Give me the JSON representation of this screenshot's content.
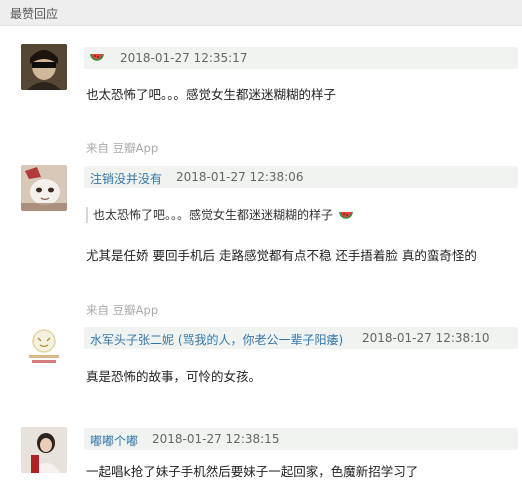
{
  "section": {
    "title": "最赞回应"
  },
  "comments": [
    {
      "author": "",
      "time": "2018-01-27 12:35:17",
      "text": "也太恐怖了吧。。。感觉女生都迷迷糊糊的样子",
      "source": "来自 豆瓣App"
    },
    {
      "author": "注销没并没有",
      "time": "2018-01-27 12:38:06",
      "quote": "也太恐怖了吧。。。感觉女生都迷迷糊糊的样子",
      "text": "尤其是任娇 要回手机后 走路感觉都有点不稳 还手捂着脸 真的蛮奇怪的",
      "source": "来自 豆瓣App"
    },
    {
      "author": "水军头子张二妮 (骂我的人，你老公一辈子阳痿)",
      "time": "2018-01-27 12:38:10",
      "text": "真是恐怖的故事，可怜的女孩。"
    },
    {
      "author": "嘟嘟个嘟",
      "time": "2018-01-27 12:38:15",
      "text": "一起唱k抢了妹子手机然后要妹子一起回家，色魔新招学习了"
    }
  ],
  "colors": {
    "link": "#3377aa",
    "meta_bg": "#f0f3f0",
    "header_bg": "#eeeeee",
    "muted": "#aaaaaa"
  },
  "icons": {
    "watermelon": "watermelon-icon"
  }
}
